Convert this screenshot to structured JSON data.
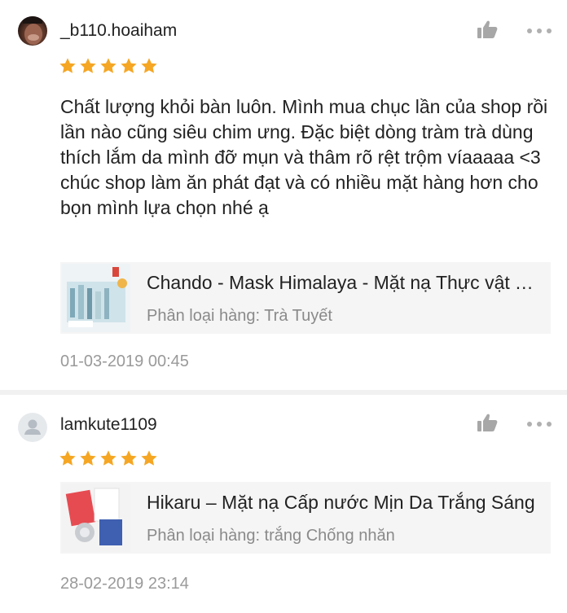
{
  "reviews": [
    {
      "username": "_b110.hoaiham",
      "rating": 5,
      "comment": "Chất lượng khỏi bàn luôn. Mình mua chục lần của shop rồi lần nào cũng siêu chim ưng. Đặc biệt dòng tràm trà dùng thích lắm da mình đỡ mụn và thâm rõ rệt trộm víaaaaa <3 chúc shop làm ăn phát đạt và có nhiều mặt hàng hơn cho bọn mình lựa chọn nhé ạ",
      "product_name": "Chando -  Mask Himalaya - Mặt nạ Thực vật Tuyết",
      "product_variant": "Phân loại hàng: Trà Tuyết",
      "date": "01-03-2019 00:45",
      "icons": {
        "avatar": "user-photo",
        "like": "thumbs-up-icon",
        "more": "more-dots-icon",
        "star": "star-icon"
      }
    },
    {
      "username": "lamkute1109",
      "rating": 5,
      "product_name": "Hikaru – Mặt nạ Cấp nước Mịn Da Trắng Sáng",
      "product_variant": "Phân loại hàng: trắng Chống nhăn",
      "date": "28-02-2019 23:14",
      "icons": {
        "avatar": "default-avatar-icon",
        "like": "thumbs-up-icon",
        "more": "more-dots-icon",
        "star": "star-icon"
      }
    }
  ],
  "colors": {
    "star": "#f5a623",
    "icon_gray": "#9b9b9b",
    "product_bg": "#f5f5f5",
    "date": "#9a9a9a"
  }
}
